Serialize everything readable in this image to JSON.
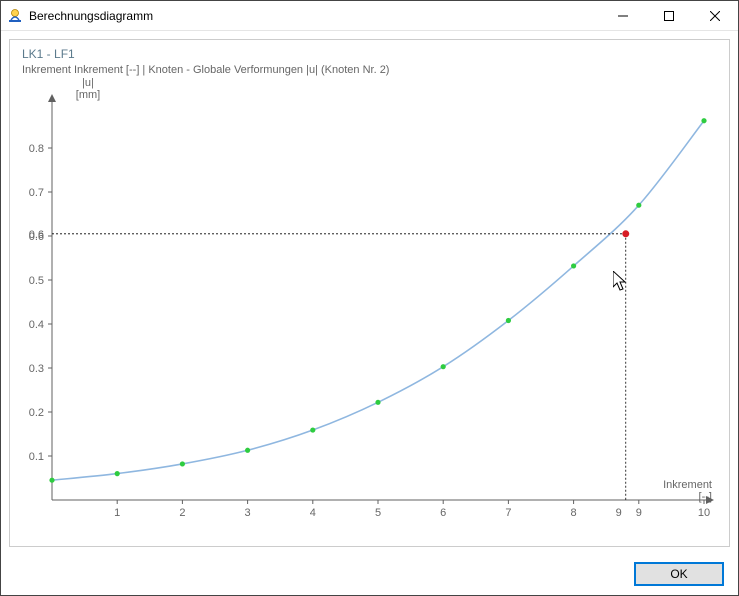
{
  "window": {
    "title": "Berechnungsdiagramm",
    "minimize_tooltip": "Minimieren",
    "maximize_tooltip": "Maximieren",
    "close_tooltip": "Schließen"
  },
  "footer": {
    "ok_label": "OK"
  },
  "chart_data": {
    "type": "line",
    "title": "LK1 - LF1",
    "subtitle": "Inkrement Inkrement [--] | Knoten - Globale Verformungen |u| (Knoten Nr. 2)",
    "xlabel": "Inkrement",
    "xunit": "[--]",
    "ylabel": "|u|",
    "yunit": "[mm]",
    "xlim": [
      0,
      10
    ],
    "ylim": [
      0,
      0.9
    ],
    "x_ticks": [
      1,
      2,
      3,
      4,
      5,
      6,
      7,
      8,
      9,
      10
    ],
    "y_ticks": [
      0.1,
      0.2,
      0.3,
      0.4,
      0.5,
      0.6,
      0.7,
      0.8
    ],
    "x": [
      0,
      1,
      2,
      3,
      4,
      5,
      6,
      7,
      8,
      9,
      10
    ],
    "values": [
      0.045,
      0.06,
      0.082,
      0.113,
      0.159,
      0.222,
      0.303,
      0.408,
      0.532,
      0.67,
      0.862
    ],
    "marker": {
      "x": 8.8,
      "y": 0.605,
      "label": "9",
      "color": "#d71c24"
    },
    "point_color": "#2ecc40",
    "line_color": "#8fb7e0",
    "axis_color": "#606060"
  }
}
